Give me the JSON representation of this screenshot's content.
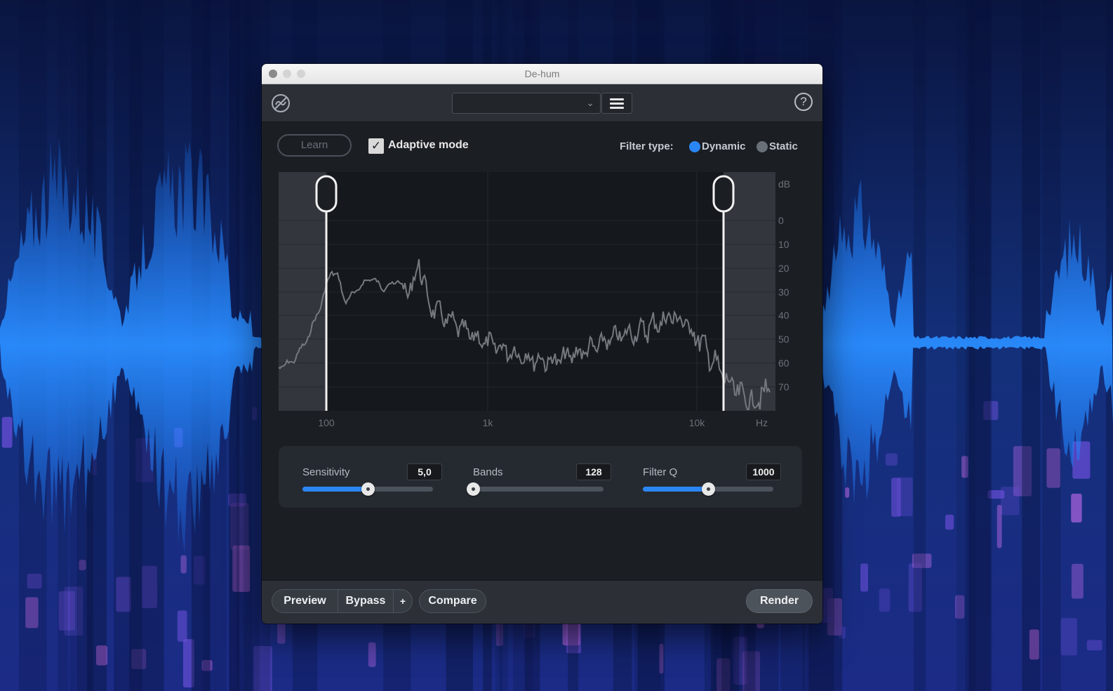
{
  "window": {
    "title": "De-hum"
  },
  "toolbar": {
    "logo_icon": "de-hum-logo-icon",
    "preset_value": "",
    "menu_icon": "hamburger-menu-icon",
    "help_glyph": "?"
  },
  "header": {
    "learn_label": "Learn",
    "adaptive_mode_label": "Adaptive mode",
    "adaptive_mode_checked": true,
    "filter_type_label": "Filter type:",
    "filter_options": [
      "Dynamic",
      "Static"
    ],
    "filter_selected": "Dynamic"
  },
  "spectrum": {
    "db_unit": "dB",
    "db_ticks": [
      "0",
      "10",
      "20",
      "30",
      "40",
      "50",
      "60",
      "70"
    ],
    "hz_unit": "Hz",
    "hz_ticks": [
      "100",
      "1k",
      "10k"
    ],
    "low_handle_hz": 100,
    "high_handle_hz": 12000
  },
  "controls": {
    "sensitivity": {
      "label": "Sensitivity",
      "value": "5,0",
      "fraction": 0.5
    },
    "bands": {
      "label": "Bands",
      "value": "128",
      "fraction": 0.0
    },
    "filter_q": {
      "label": "Filter Q",
      "value": "1000",
      "fraction": 0.5
    }
  },
  "bottom": {
    "preview_label": "Preview",
    "bypass_label": "Bypass",
    "plus_label": "+",
    "compare_label": "Compare",
    "render_label": "Render"
  },
  "colors": {
    "accent": "#2b86f5",
    "panel": "#1b1e23",
    "toolbar": "#2c3036"
  }
}
